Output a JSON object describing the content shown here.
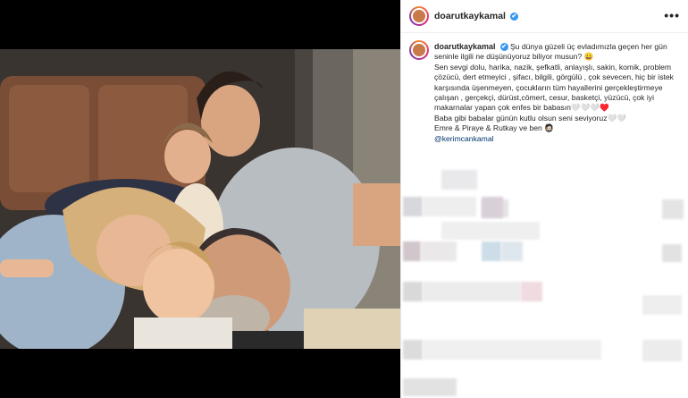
{
  "post": {
    "username": "doarutkaykamal",
    "verified_mark": "✔",
    "more_label": "•••",
    "caption_lines": [
      "Şu dünya güzeli üç evladımızla geçen her gün seninle ilgili ne düşünüyoruz biliyor musun? 😀",
      "Sen sevgi dolu, harika, nazik, şefkatli, anlayışlı, sakin, komik, problem çözücü, dert etmeyici , şifacı, bilgili, görgülü , çok sevecen, hiç bir istek karşısında üşenmeyen, çocukların tüm hayallerini gerçekleştirmeye çalışan , gerçekçi, dürüst,cömert, cesur, basketçi, yüzücü, çok iyi makarnalar yapan çok enfes bir babasın🤍🤍🤍♥️",
      "Baba gibi babalar günün kutlu olsun seni seviyoruz🤍🤍",
      "Emre & Piraye & Rutkay ve ben 🧔🏻"
    ],
    "mention": "@kerimcankamal"
  },
  "icons": {
    "avatar": "profile-avatar-icon",
    "verified": "verified-badge-icon",
    "more": "more-options-icon",
    "tag": "tagged-people-icon"
  },
  "colors": {
    "username": "#262626",
    "verified": "#3897f0",
    "mention": "#00376b",
    "letterbox": "#000000"
  }
}
